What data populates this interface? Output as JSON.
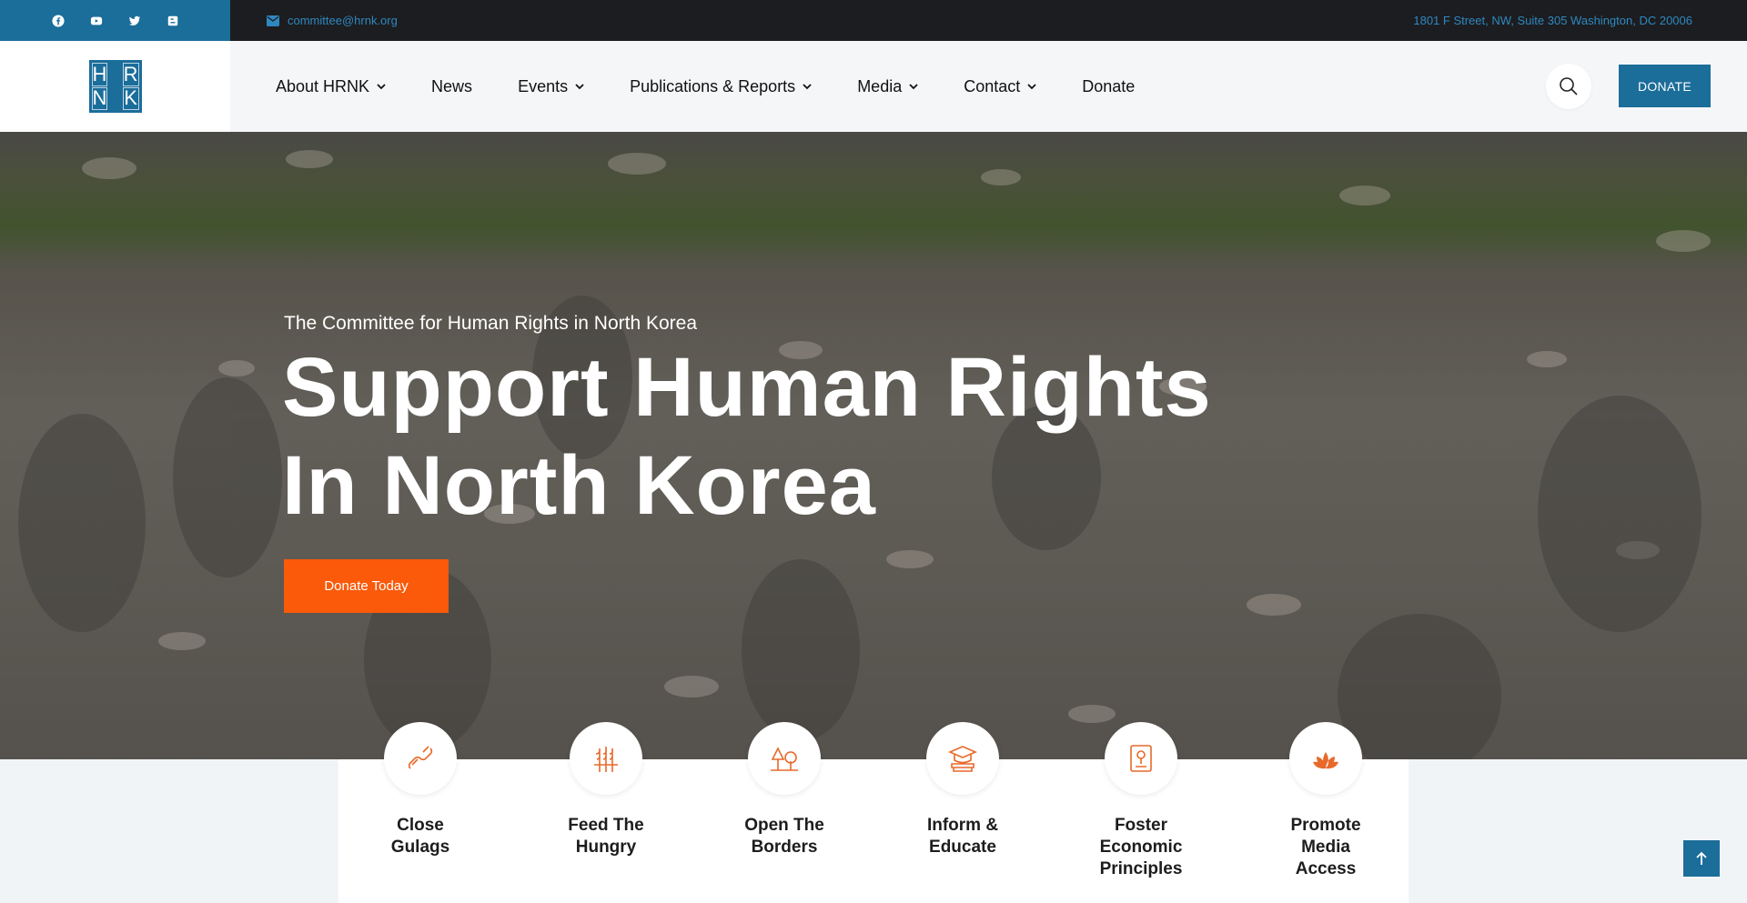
{
  "topbar": {
    "social": [
      "facebook-icon",
      "youtube-icon",
      "twitter-icon",
      "blogger-icon"
    ],
    "email": "committee@hrnk.org",
    "address": "1801 F Street, NW, Suite 305 Washington, DC 20006"
  },
  "logo": {
    "letters": [
      "H",
      "R",
      "N",
      "K"
    ]
  },
  "nav": {
    "items": [
      {
        "label": "About HRNK",
        "has_dropdown": true
      },
      {
        "label": "News",
        "has_dropdown": false
      },
      {
        "label": "Events",
        "has_dropdown": true
      },
      {
        "label": "Publications & Reports",
        "has_dropdown": true
      },
      {
        "label": "Media",
        "has_dropdown": true
      },
      {
        "label": "Contact",
        "has_dropdown": true
      },
      {
        "label": "Donate",
        "has_dropdown": false
      }
    ],
    "donate_button": "DONATE"
  },
  "hero": {
    "subtitle": "The Committee for Human Rights in North Korea",
    "title_line1": "Support Human Rights",
    "title_line2": "In North Korea",
    "button": "Donate Today"
  },
  "features": [
    {
      "lines": [
        "Close",
        "Gulags"
      ],
      "icon": "broken-chain-icon"
    },
    {
      "lines": [
        "Feed The",
        "Hungry"
      ],
      "icon": "wheat-icon"
    },
    {
      "lines": [
        "Open The",
        "Borders"
      ],
      "icon": "trees-icon"
    },
    {
      "lines": [
        "Inform &",
        "Educate"
      ],
      "icon": "graduation-books-icon"
    },
    {
      "lines": [
        "Foster",
        "Economic",
        "Principles"
      ],
      "icon": "document-icon"
    },
    {
      "lines": [
        "Promote",
        "Media",
        "Access"
      ],
      "icon": "lotus-icon"
    }
  ],
  "colors": {
    "brand_blue": "#1b6d9a",
    "accent_orange": "#fa5a0a",
    "dark": "#1c1d20"
  }
}
